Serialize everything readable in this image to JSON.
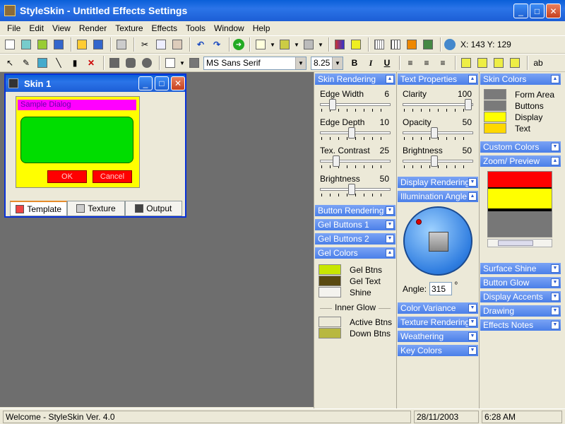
{
  "app": {
    "title": "StyleSkin - Untitled Effects Settings"
  },
  "menu": [
    "File",
    "Edit",
    "View",
    "Render",
    "Texture",
    "Effects",
    "Tools",
    "Window",
    "Help"
  ],
  "toolbar": {
    "coords": "X: 143 Y: 129",
    "font_name": "MS Sans Serif",
    "font_size": "8.25",
    "bold": "B",
    "italic": "I",
    "underline": "U",
    "text_tool": "ab"
  },
  "child_window": {
    "title": "Skin 1",
    "sample_title": "Sample Dialog",
    "ok": "OK",
    "cancel": "Cancel",
    "tabs": [
      "Template",
      "Texture",
      "Output"
    ]
  },
  "col1": {
    "skin_rendering": "Skin Rendering",
    "sliders": [
      {
        "label": "Edge Width",
        "value": "6",
        "level": 0.15
      },
      {
        "label": "Edge Depth",
        "value": "10",
        "level": 0.45
      },
      {
        "label": "Tex. Contrast",
        "value": "25",
        "level": 0.2
      },
      {
        "label": "Brightness",
        "value": "50",
        "level": 0.45
      }
    ],
    "sections": [
      "Button Rendering",
      "Gel Buttons 1",
      "Gel Buttons 2"
    ],
    "gel_colors": "Gel Colors",
    "gel_swatches": [
      {
        "label": "Gel Btns",
        "color": "#c8e600"
      },
      {
        "label": "Gel Text",
        "color": "#5a4a10"
      },
      {
        "label": "Shine",
        "color": "#f4f3ee"
      }
    ],
    "inner_glow": "Inner Glow",
    "glow_swatches": [
      {
        "label": "Active Btns",
        "color": "#ece9d8"
      },
      {
        "label": "Down Btns",
        "color": "#b8b840"
      }
    ]
  },
  "col2": {
    "text_properties": "Text Properties",
    "sliders": [
      {
        "label": "Clarity",
        "value": "100",
        "level": 1.0
      },
      {
        "label": "Opacity",
        "value": "50",
        "level": 0.45
      },
      {
        "label": "Brightness",
        "value": "50",
        "level": 0.45
      }
    ],
    "display_rendering": "Display Rendering",
    "illumination_angle": "Illumination Angle",
    "angle_label": "Angle:",
    "angle_value": "315",
    "angle_unit": "º",
    "sections": [
      "Color Variance",
      "Texture Rendering",
      "Weathering",
      "Key Colors"
    ]
  },
  "col3": {
    "skin_colors": "Skin Colors",
    "swatches": [
      {
        "label": "Form Area",
        "color": "#7a7a7a"
      },
      {
        "label": "Buttons",
        "color": "#7a7a7a"
      },
      {
        "label": "Display",
        "color": "#ffff00"
      },
      {
        "label": "Text",
        "color": "#ffd800"
      }
    ],
    "custom_colors": "Custom Colors",
    "zoom_preview": "Zoom/ Preview",
    "sections": [
      "Surface Shine",
      "Button Glow",
      "Display Accents",
      "Drawing",
      "Effects Notes"
    ]
  },
  "status": {
    "message": "Welcome - StyleSkin Ver. 4.0",
    "date": "28/11/2003",
    "time": "6:28 AM"
  }
}
